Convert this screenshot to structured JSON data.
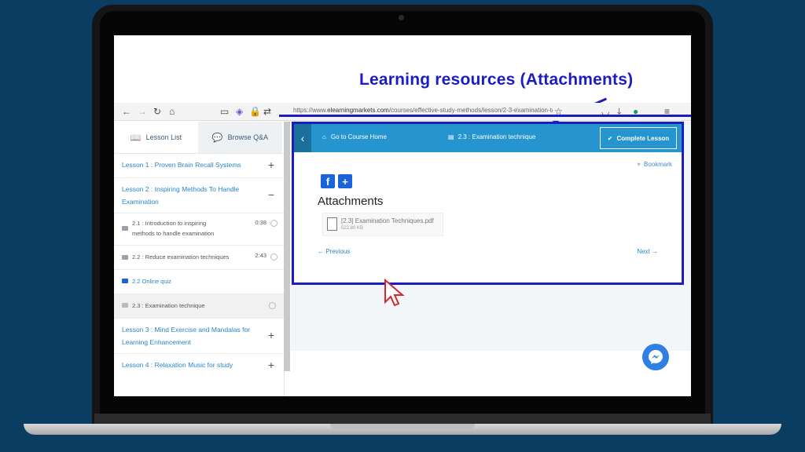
{
  "overlay": {
    "headline": "Learning resources (Attachments)"
  },
  "browser": {
    "url_prefix": "https://www.",
    "url_domain": "elearningmarkets.com",
    "url_path": "/courses/effective-study-methods/lesson/2-3-examination-techniq"
  },
  "sidebar": {
    "tabs": [
      {
        "label": "Lesson List",
        "active": true
      },
      {
        "label": "Browse Q&A",
        "active": false
      }
    ],
    "lesson1": {
      "label": "Lesson 1 : Proven Brain Recall Systems",
      "toggle": "+"
    },
    "lesson2": {
      "label_line1": "Lesson 2 : Inspiring Methods To Handle",
      "label_line2": "Examination",
      "toggle": "−",
      "items": [
        {
          "line1": "2.1 : Introduction to inspiring",
          "line2": "methods to handle examination",
          "duration": "0:38"
        },
        {
          "line1": "2.2 : Reduce examination techniques",
          "duration": "2:43"
        },
        {
          "line1": "2.2 Online quiz"
        },
        {
          "line1": "2.3 : Examination technique"
        }
      ]
    },
    "lesson3": {
      "label_line1": "Lesson 3 : Mind Exercise and Mandalas for",
      "label_line2": "Learning Enhancement",
      "toggle": "+"
    },
    "lesson4": {
      "label": "Lesson 4 : Relaxation Music for study",
      "toggle": "+"
    }
  },
  "lesson_bar": {
    "back": "‹",
    "go_home": "Go to Course Home",
    "current_lesson": "2.3 : Examination technique",
    "complete_label": "Complete Lesson"
  },
  "content": {
    "bookmark": "Bookmark",
    "attachments_title": "Attachments",
    "file": {
      "name": "[2.3] Examination Techniques.pdf",
      "size": "522.80 KB"
    },
    "prev": "← Previous",
    "next": "Next →"
  },
  "colors": {
    "annotation_blue": "#1c1cc4",
    "lesson_bar_blue": "#2594cf",
    "link_blue": "#2a86c5"
  }
}
